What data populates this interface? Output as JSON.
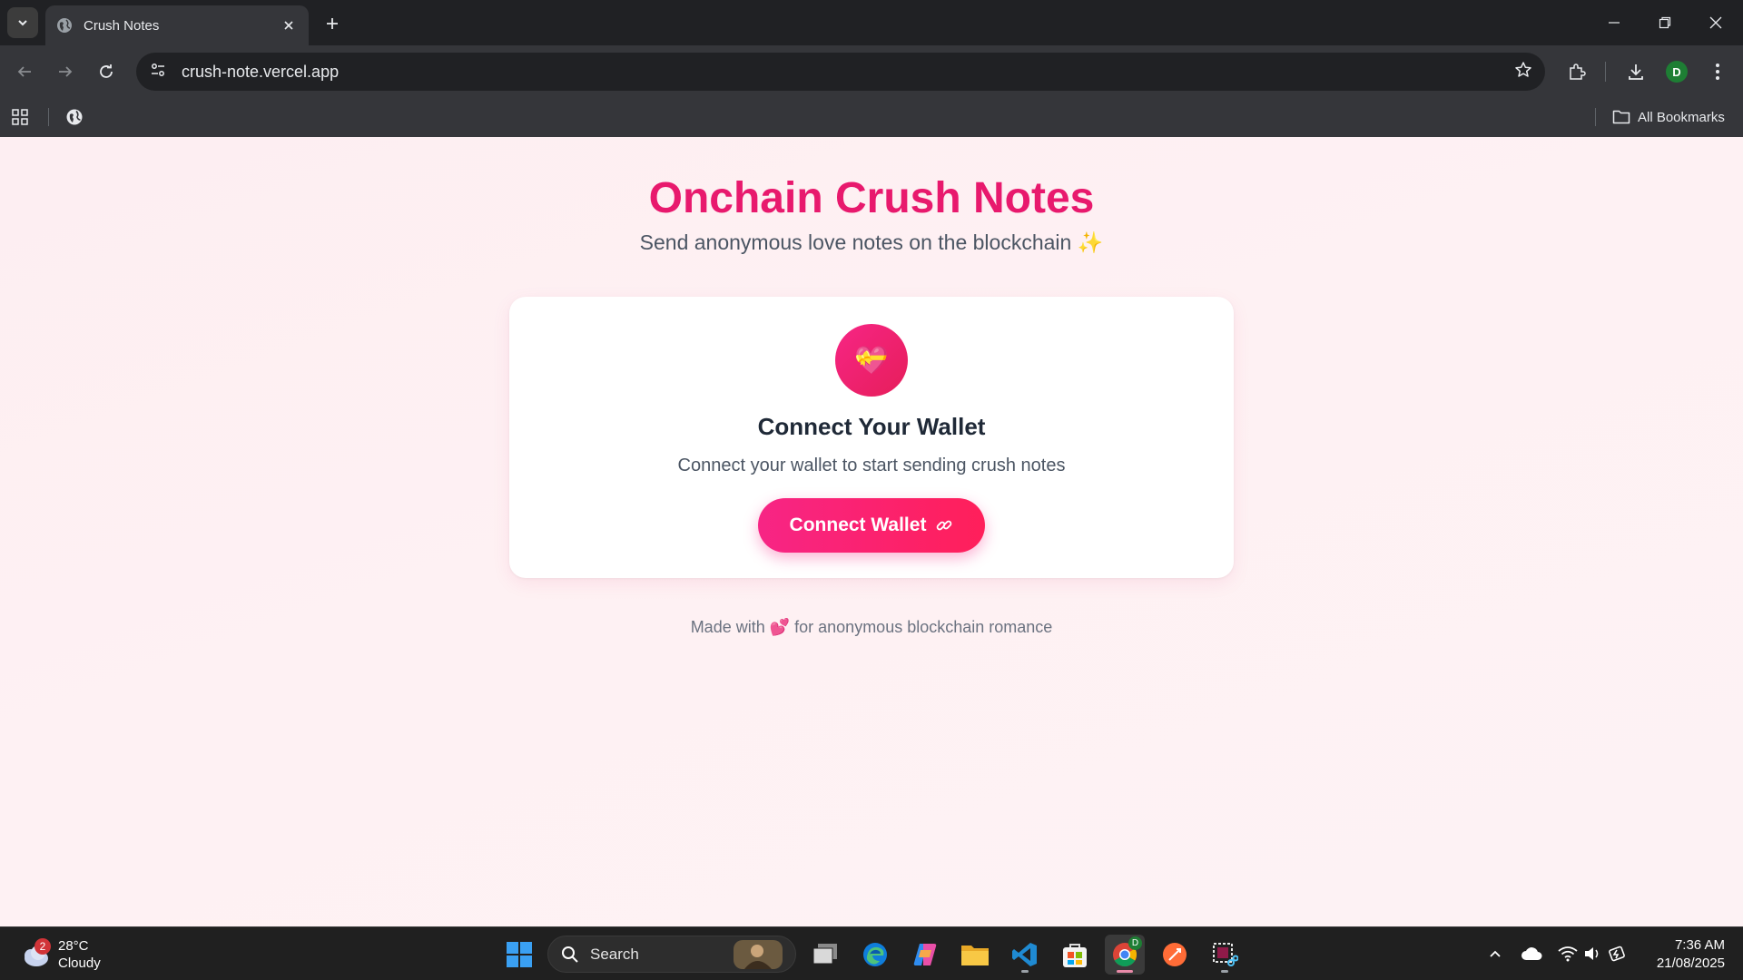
{
  "browser": {
    "tab_title": "Crush Notes",
    "url": "crush-note.vercel.app",
    "all_bookmarks_label": "All Bookmarks",
    "profile_initial": "D"
  },
  "page": {
    "title": "Onchain Crush Notes",
    "subtitle": "Send anonymous love notes on the blockchain ✨",
    "card": {
      "icon": "💝",
      "title": "Connect Your Wallet",
      "description": "Connect your wallet to start sending crush notes",
      "button_label": "Connect Wallet"
    },
    "footer": "Made with 💕 for anonymous blockchain romance"
  },
  "taskbar": {
    "weather_temp": "28°C",
    "weather_desc": "Cloudy",
    "weather_badge": "2",
    "search_label": "Search",
    "time": "7:36 AM",
    "date": "21/08/2025",
    "chrome_badge": "D"
  },
  "colors": {
    "accent": "#e8196d",
    "button_gradient_start": "#f72585",
    "button_gradient_end": "#ff1f5a"
  }
}
